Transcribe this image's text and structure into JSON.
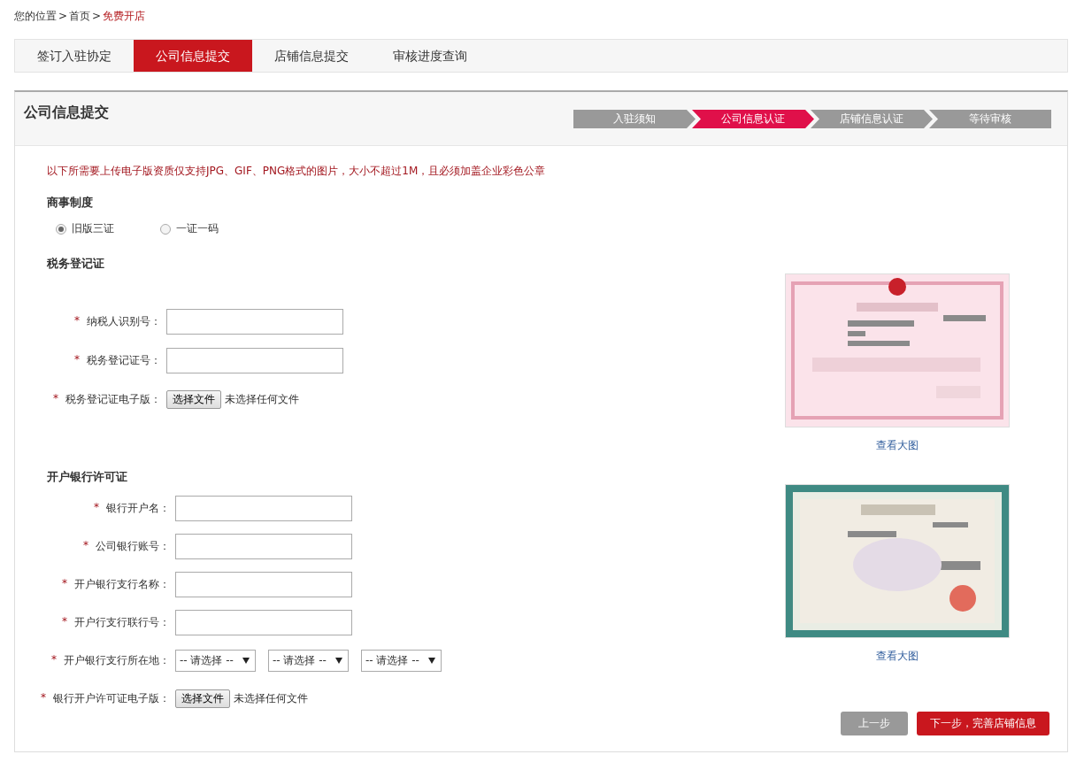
{
  "breadcrumb": {
    "separator": ">",
    "items": [
      {
        "label": "您的位置",
        "current": false
      },
      {
        "label": "首页",
        "current": false
      },
      {
        "label": "免费开店",
        "current": true
      }
    ]
  },
  "tabs": [
    {
      "label": "签订入驻协定",
      "selected": false
    },
    {
      "label": "公司信息提交",
      "selected": true
    },
    {
      "label": "店铺信息提交",
      "selected": false
    },
    {
      "label": "审核进度查询",
      "selected": false
    }
  ],
  "panel": {
    "title": "公司信息提交",
    "steps": [
      {
        "label": "入驻须知",
        "selected": false
      },
      {
        "label": "公司信息认证",
        "selected": true
      },
      {
        "label": "店铺信息认证",
        "selected": false
      },
      {
        "label": "等待审核",
        "selected": false
      }
    ]
  },
  "notice": "以下所需要上传电子版资质仅支持JPG、GIF、PNG格式的图片，大小不超过1M，且必须加盖企业彩色公章",
  "business_system": {
    "title": "商事制度",
    "options": [
      {
        "label": "旧版三证",
        "selected": true
      },
      {
        "label": "一证一码",
        "selected": false
      }
    ]
  },
  "sections": [
    {
      "title": "税务登记证",
      "image_link": "查看大图",
      "fields": [
        {
          "kind": "text",
          "label": "纳税人识别号：",
          "required_mark": "*"
        },
        {
          "kind": "text",
          "label": "税务登记证号：",
          "required_mark": "*"
        },
        {
          "kind": "file",
          "label": "税务登记证电子版：",
          "required_mark": "*",
          "button": "选择文件",
          "status": "未选择任何文件"
        }
      ]
    },
    {
      "title": "开户银行许可证",
      "image_link": "查看大图",
      "fields": [
        {
          "kind": "text",
          "label": "银行开户名：",
          "required_mark": "*"
        },
        {
          "kind": "text",
          "label": "公司银行账号：",
          "required_mark": "*"
        },
        {
          "kind": "text",
          "label": "开户银行支行名称：",
          "required_mark": "*"
        },
        {
          "kind": "text",
          "label": "开户行支行联行号：",
          "required_mark": "*"
        },
        {
          "kind": "select",
          "label": "开户银行支行所在地：",
          "required_mark": "*",
          "selects": [
            "-- 请选择 --",
            "-- 请选择 --",
            "-- 请选择 --"
          ]
        },
        {
          "kind": "file",
          "label": "银行开户许可证电子版：",
          "required_mark": "*",
          "button": "选择文件",
          "status": "未选择任何文件"
        }
      ]
    }
  ],
  "buttons": [
    {
      "label": "上一步",
      "kind": "secondary"
    },
    {
      "label": "下一步，完善店铺信息",
      "kind": "primary"
    }
  ]
}
